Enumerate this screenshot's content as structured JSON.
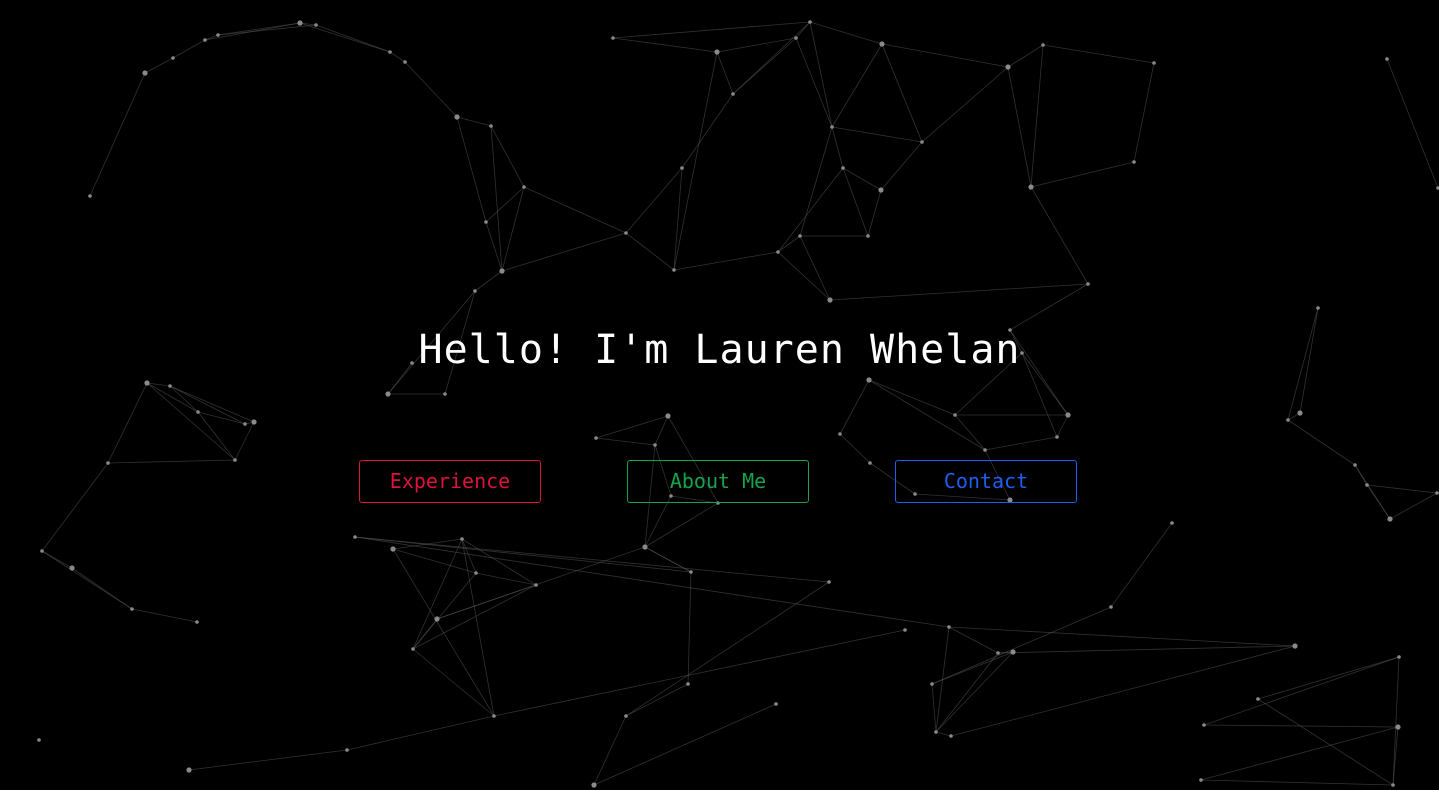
{
  "hero": {
    "greeting": "Hello! I'm Lauren Whelan"
  },
  "nav": {
    "experience_label": "Experience",
    "about_label": "About Me",
    "contact_label": "Contact"
  },
  "colors": {
    "background": "#000000",
    "headline": "#ffffff",
    "experience": "#dc143c",
    "about": "#16a34a",
    "contact": "#1e5ef0",
    "network_line": "#5a5a5a",
    "network_node": "#8a8a8a"
  }
}
